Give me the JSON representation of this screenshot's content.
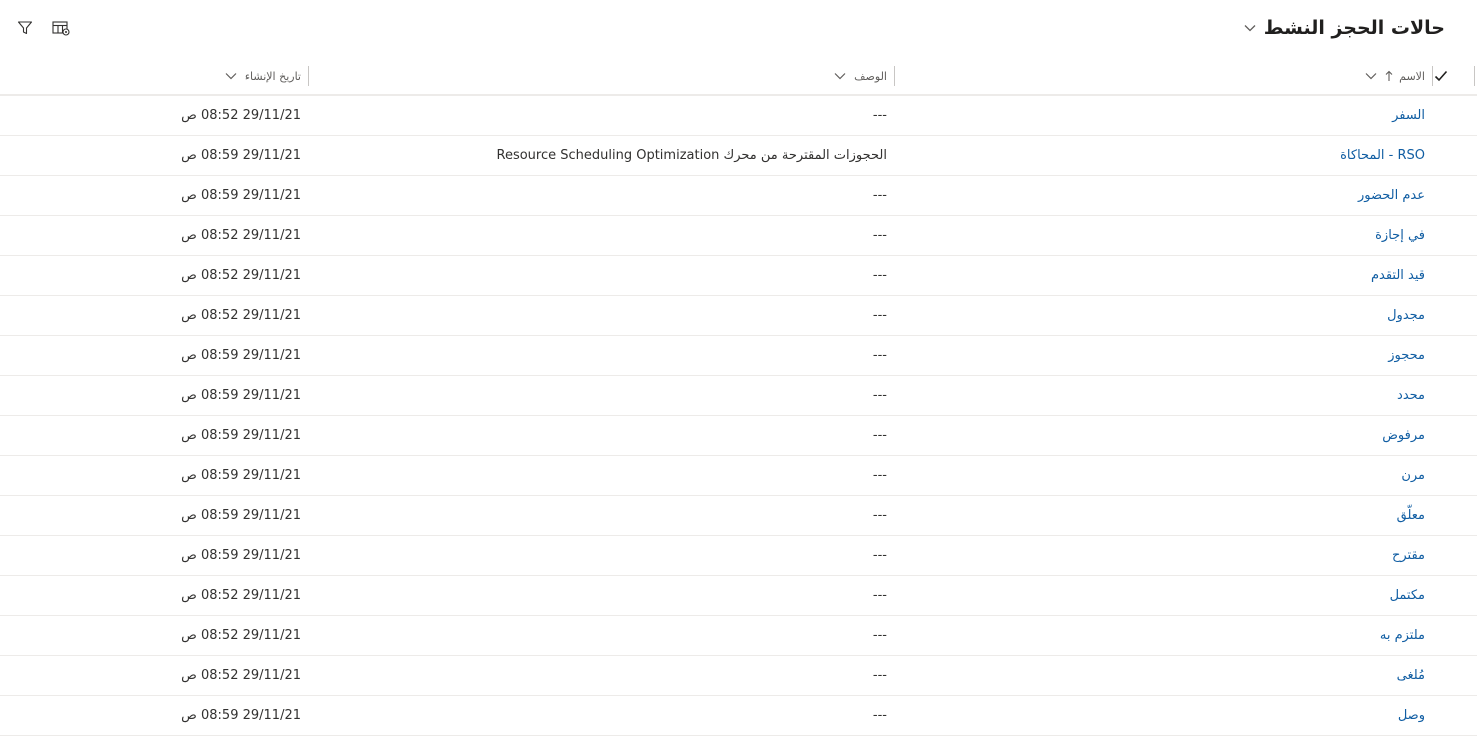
{
  "view": {
    "title": "حالات الحجز النشط"
  },
  "icons": {
    "title_chevron": "chevron-down-icon",
    "filter": "filter-icon",
    "edit_columns": "edit-columns-icon",
    "select_all": "checkmark-icon",
    "sort": "arrow-up-icon"
  },
  "colors": {
    "link": "#115ea3",
    "text": "#323130",
    "header_text": "#605e5c",
    "divider": "#edebe9"
  },
  "columns": [
    {
      "label": "الاسم",
      "sorted": "ascending"
    },
    {
      "label": "الوصف"
    },
    {
      "label": "تاريخ الإنشاء"
    }
  ],
  "rows": [
    {
      "name": "السفر",
      "description": "---",
      "created": "29/11/21 08:52 ص"
    },
    {
      "name": "RSO - المحاكاة",
      "description": "الحجوزات المقترحة من محرك Resource Scheduling Optimization",
      "created": "29/11/21 08:59 ص"
    },
    {
      "name": "عدم الحضور",
      "description": "---",
      "created": "29/11/21 08:59 ص"
    },
    {
      "name": "في إجازة",
      "description": "---",
      "created": "29/11/21 08:52 ص"
    },
    {
      "name": "قيد التقدم",
      "description": "---",
      "created": "29/11/21 08:52 ص"
    },
    {
      "name": "مجدول",
      "description": "---",
      "created": "29/11/21 08:52 ص"
    },
    {
      "name": "محجوز",
      "description": "---",
      "created": "29/11/21 08:59 ص"
    },
    {
      "name": "محدد",
      "description": "---",
      "created": "29/11/21 08:59 ص"
    },
    {
      "name": "مرفوض",
      "description": "---",
      "created": "29/11/21 08:59 ص"
    },
    {
      "name": "مرن",
      "description": "---",
      "created": "29/11/21 08:59 ص"
    },
    {
      "name": "معلّق",
      "description": "---",
      "created": "29/11/21 08:59 ص"
    },
    {
      "name": "مقترح",
      "description": "---",
      "created": "29/11/21 08:59 ص"
    },
    {
      "name": "مكتمل",
      "description": "---",
      "created": "29/11/21 08:52 ص"
    },
    {
      "name": "ملتزم به",
      "description": "---",
      "created": "29/11/21 08:52 ص"
    },
    {
      "name": "مُلغى",
      "description": "---",
      "created": "29/11/21 08:52 ص"
    },
    {
      "name": "وصل",
      "description": "---",
      "created": "29/11/21 08:59 ص"
    }
  ]
}
